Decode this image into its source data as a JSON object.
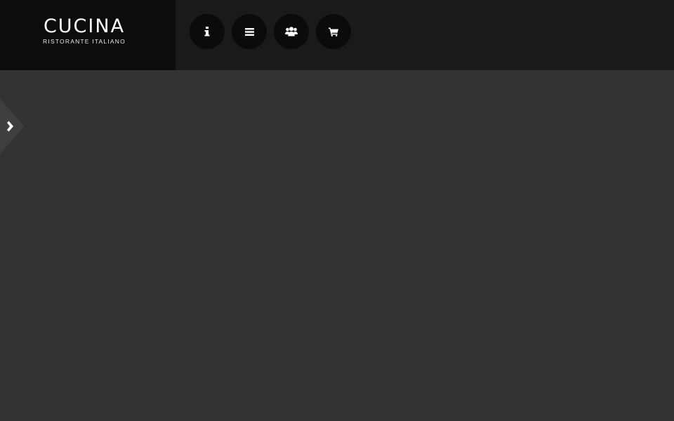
{
  "brand": {
    "title": "CUCINA",
    "subtitle": "RISTORANTE ITALIANO"
  },
  "nav": {
    "items": [
      {
        "icon": "info-icon"
      },
      {
        "icon": "menu-icon"
      },
      {
        "icon": "users-icon"
      },
      {
        "icon": "cart-icon"
      }
    ]
  },
  "sidebar_toggle": {
    "icon": "chevron-right-icon"
  },
  "colors": {
    "header_bg": "#1a1a1a",
    "logo_bg": "#0c0c0c",
    "nav_button_bg": "#0b0b0b",
    "page_bg": "#333333",
    "tab_bg": "#3d3d3d",
    "icon": "#ffffff"
  }
}
